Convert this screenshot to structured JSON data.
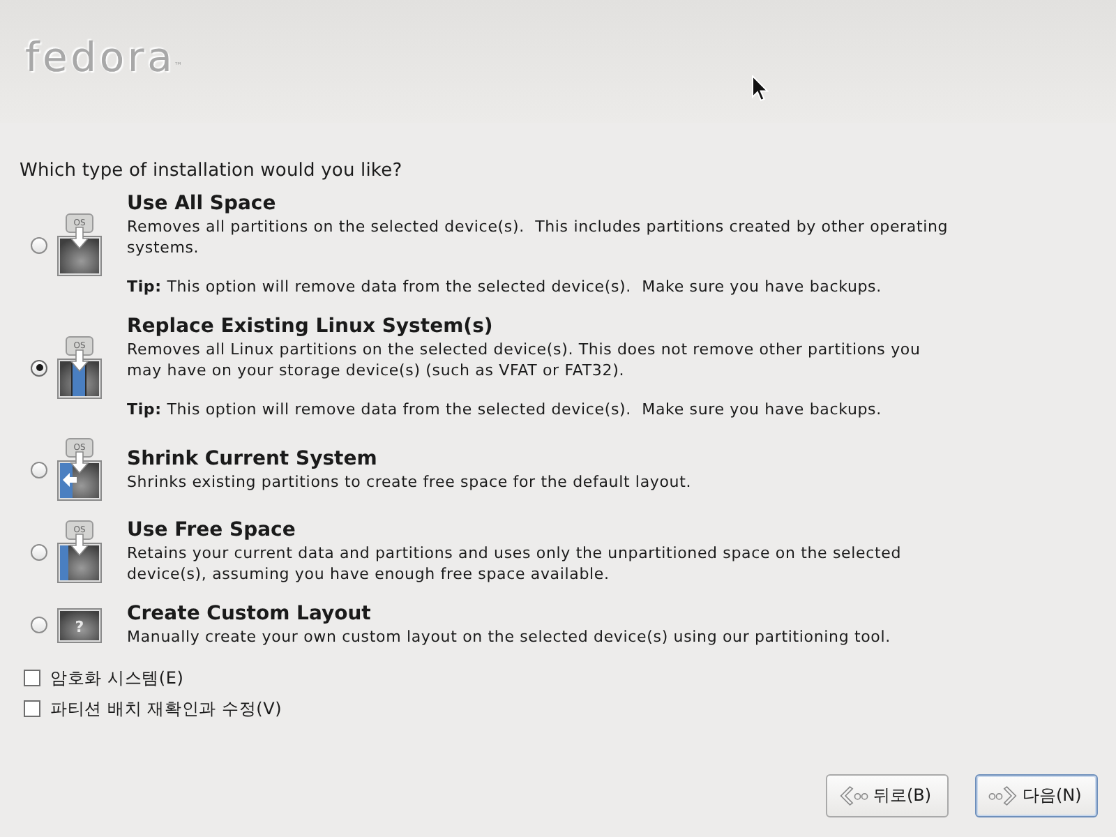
{
  "header": {
    "logo": "fedora",
    "logo_mark": "™"
  },
  "question": "Which type of installation would you like?",
  "options": [
    {
      "kind": "all",
      "icon_label": "OS",
      "title": "Use All Space",
      "description": "Removes all partitions on the selected device(s).  This includes partitions created by other operating systems.",
      "tip": "**Tip:** This option will remove data from the selected device(s).  Make sure you have backups.",
      "selected": false
    },
    {
      "kind": "replace",
      "icon_label": "OS",
      "title": "Replace Existing Linux System(s)",
      "description": "Removes all Linux partitions on the selected device(s). This does not remove other partitions you may have on your storage device(s) (such as VFAT or FAT32).",
      "tip": "**Tip:** This option will remove data from the selected device(s).  Make sure you have backups.",
      "selected": true
    },
    {
      "kind": "shrink",
      "icon_label": "OS",
      "title": "Shrink Current System",
      "description": "Shrinks existing partitions to create free space for the default layout.",
      "selected": false
    },
    {
      "kind": "free",
      "icon_label": "OS",
      "title": "Use Free Space",
      "description": "Retains your current data and partitions and uses only the unpartitioned space on the selected device(s), assuming you have enough free space available.",
      "selected": false
    },
    {
      "kind": "custom",
      "icon_label": "?",
      "title": "Create Custom Layout",
      "description": "Manually create your own custom layout on the selected device(s) using our partitioning tool.",
      "selected": false
    }
  ],
  "checkboxes": [
    {
      "label": "암호화 시스템(E)",
      "checked": false
    },
    {
      "label": "파티션 배치 재확인과 수정(V)",
      "checked": false
    }
  ],
  "buttons": [
    {
      "kind": "back",
      "label": "뒤로(B)",
      "focused": false
    },
    {
      "kind": "next",
      "label": "다음(N)",
      "focused": true
    }
  ]
}
